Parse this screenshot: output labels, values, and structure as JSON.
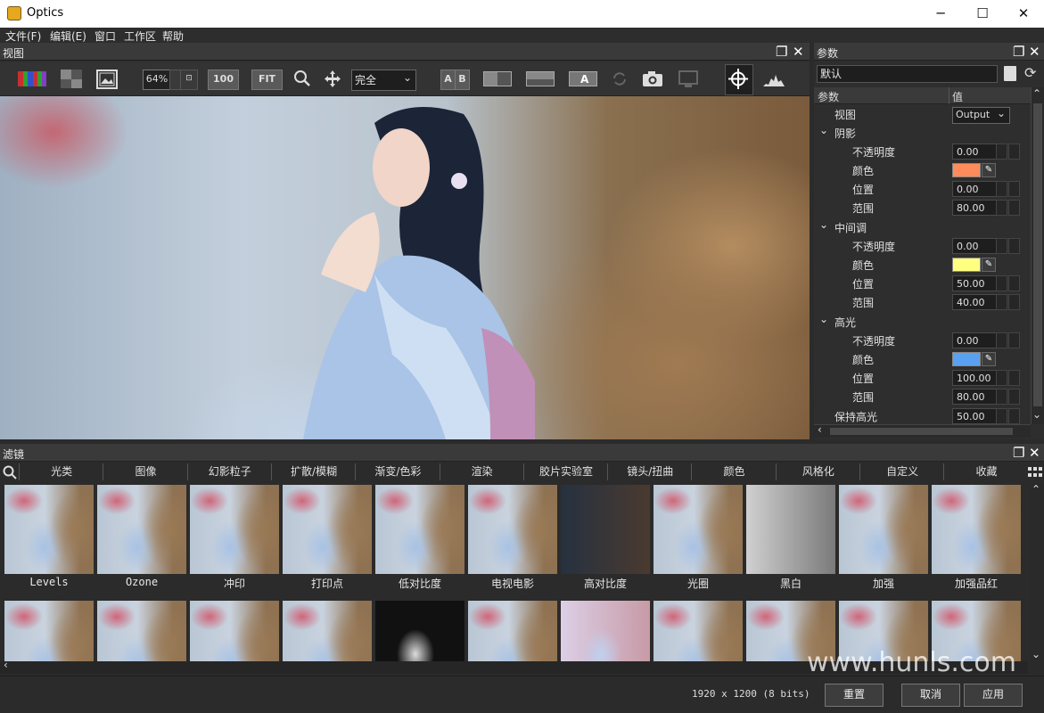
{
  "window": {
    "title": "Optics",
    "controls": {
      "minimize": "─",
      "maximize": "☐",
      "close": "✕"
    }
  },
  "menubar": {
    "items": [
      "文件(F)",
      "编辑(E)",
      "窗口",
      "工作区",
      "帮助"
    ]
  },
  "view_panel": {
    "title": "视图",
    "zoom_value": "64%",
    "btn_100": "100",
    "btn_fit": "FIT",
    "mode_select": "完全",
    "btn_ab_a": "A",
    "btn_ab_b": "B"
  },
  "params_panel": {
    "title": "参数",
    "preset_value": "默认",
    "col_param": "参数",
    "col_value": "值",
    "view_label": "视图",
    "view_select": "Output",
    "groups": [
      {
        "name": "阴影",
        "rows": [
          {
            "label": "不透明度",
            "value": "0.00"
          },
          {
            "label": "颜色",
            "color": "#ff8c5a"
          },
          {
            "label": "位置",
            "value": "0.00"
          },
          {
            "label": "范围",
            "value": "80.00"
          }
        ]
      },
      {
        "name": "中间调",
        "rows": [
          {
            "label": "不透明度",
            "value": "0.00"
          },
          {
            "label": "颜色",
            "color": "#ffff80"
          },
          {
            "label": "位置",
            "value": "50.00"
          },
          {
            "label": "范围",
            "value": "40.00"
          }
        ]
      },
      {
        "name": "高光",
        "rows": [
          {
            "label": "不透明度",
            "value": "0.00"
          },
          {
            "label": "颜色",
            "color": "#5aa0f0"
          },
          {
            "label": "位置",
            "value": "100.00"
          },
          {
            "label": "范围",
            "value": "80.00"
          }
        ]
      }
    ],
    "keep_highlight_label": "保持高光",
    "keep_highlight_value": "50.00"
  },
  "filter_panel": {
    "title": "滤镜",
    "categories": [
      "光类",
      "图像",
      "幻影粒子",
      "扩散/模糊",
      "渐变/色彩",
      "渲染",
      "胶片实验室",
      "镜头/扭曲",
      "颜色",
      "风格化",
      "自定义",
      "收藏"
    ],
    "row1_labels": [
      "Levels",
      "Ozone",
      "冲印",
      "打印点",
      "低对比度",
      "电视电影",
      "高对比度",
      "光圈",
      "黑白",
      "加强",
      "加强品红"
    ]
  },
  "status": {
    "image_info": "1920 x 1200 (8 bits)"
  },
  "buttons": {
    "reset": "重置",
    "cancel": "取消",
    "apply": "应用"
  },
  "watermark": "www.hunls.com"
}
